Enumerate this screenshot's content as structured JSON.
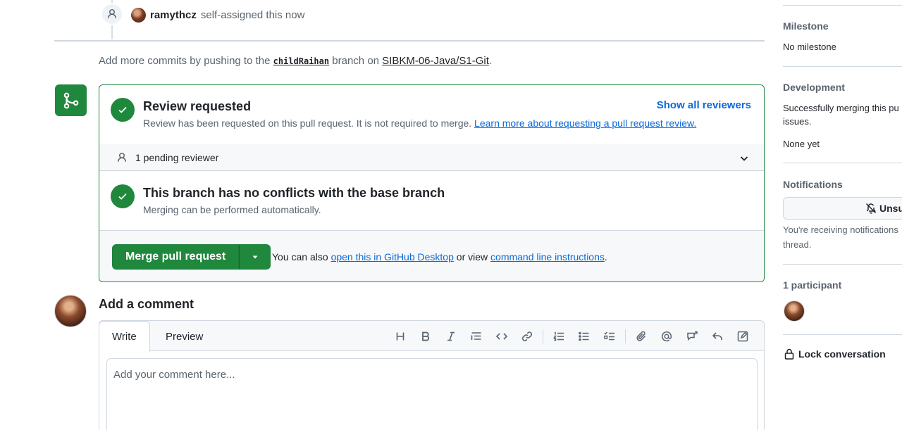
{
  "timeline": {
    "user": "ramythcz",
    "action": "self-assigned this now"
  },
  "commits_note": {
    "prefix": "Add more commits by pushing to the",
    "branch": "childRaihan",
    "middle": "branch on",
    "repo": "SIBKM-06-Java/S1-Git",
    "suffix": "."
  },
  "mergebox": {
    "review_title": "Review requested",
    "review_desc": "Review has been requested on this pull request. It is not required to merge.",
    "review_link": "Learn more about requesting a pull request review.",
    "show_all_reviewers": "Show all reviewers",
    "pending_reviewer": "1 pending reviewer",
    "conflicts_title": "This branch has no conflicts with the base branch",
    "conflicts_desc": "Merging can be performed automatically.",
    "merge_button": "Merge pull request",
    "also_text": "You can also",
    "desktop_link": "open this in GitHub Desktop",
    "or_view": "or view",
    "cli_link": "command line instructions",
    "end": "."
  },
  "comment": {
    "heading": "Add a comment",
    "tab_write": "Write",
    "tab_preview": "Preview",
    "placeholder": "Add your comment here..."
  },
  "sidebar": {
    "milestone_h": "Milestone",
    "milestone_v": "No milestone",
    "development_h": "Development",
    "development_desc": "Successfully merging this pu",
    "development_desc2": "issues.",
    "development_v": "None yet",
    "notifications_h": "Notifications",
    "unsubscribe": "Unsu",
    "notif_desc": "You're receiving notifications",
    "notif_desc2": "thread.",
    "participants_h": "1 participant",
    "lock": "Lock conversation"
  },
  "colors": {
    "success": "#1f883d",
    "link": "#0969da",
    "muted": "#59636e"
  }
}
